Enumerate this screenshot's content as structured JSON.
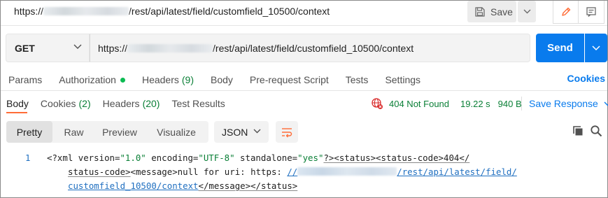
{
  "title_bar": {
    "url_prefix": "https://",
    "url_suffix": "/rest/api/latest/field/customfield_10500/context",
    "save_label": "Save"
  },
  "request": {
    "method": "GET",
    "url_prefix": "https://",
    "url_suffix": "/rest/api/latest/field/customfield_10500/context",
    "send_label": "Send"
  },
  "request_tabs": {
    "params": "Params",
    "authorization": "Authorization",
    "headers": "Headers",
    "headers_count": "(9)",
    "body": "Body",
    "prerequest": "Pre-request Script",
    "tests": "Tests",
    "settings": "Settings",
    "cookies_link": "Cookies"
  },
  "response_tabs": {
    "body": "Body",
    "cookies": "Cookies",
    "cookies_count": "(2)",
    "headers": "Headers",
    "headers_count": "(20)",
    "test_results": "Test Results"
  },
  "response_status": {
    "status": "404 Not Found",
    "time": "19.22 s",
    "size": "940 B",
    "save_response": "Save Response"
  },
  "view_modes": [
    "Pretty",
    "Raw",
    "Preview",
    "Visualize"
  ],
  "active_view_mode": "Pretty",
  "format": "JSON",
  "code": {
    "line_number": "1",
    "xml_open": "<?xml ",
    "attr_version": "version=",
    "val_version": "\"1.0\"",
    "attr_encoding": " encoding=",
    "val_encoding": "\"UTF-8\"",
    "attr_standalone": " standalone=",
    "val_standalone": "\"yes\"",
    "line1_tail": "?><status><status-code>404</",
    "line2_a": "status-code>",
    "line2_b": "<message>null for uri: https: ",
    "line2_link_prefix": "//",
    "line2_link_suffix": "/rest/api/latest/field/",
    "line3_link": "customfield_10500/context",
    "line3_tail": "</message></status>"
  },
  "colors": {
    "accent_orange": "#ff6c37",
    "send_blue": "#097bed",
    "status_green": "#0a7f36",
    "error_red": "#d92c2c"
  },
  "icons": [
    "save-icon",
    "chevron-down-icon",
    "pencil-icon",
    "comment-icon",
    "globe-error-icon",
    "wrap-lines-icon",
    "copy-icon",
    "search-icon"
  ]
}
